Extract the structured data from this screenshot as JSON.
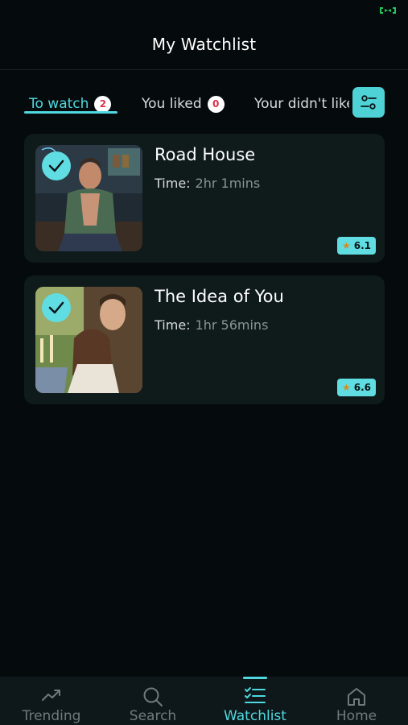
{
  "header": {
    "title": "My Watchlist"
  },
  "tabs": [
    {
      "label": "To watch",
      "count": "2",
      "active": true
    },
    {
      "label": "You liked",
      "count": "0",
      "active": false
    },
    {
      "label": "Your didn't like",
      "active": false
    }
  ],
  "movies": [
    {
      "title": "Road House",
      "time_label": "Time:",
      "time": "2hr 1mins",
      "rating": "6.1",
      "watched": true
    },
    {
      "title": "The Idea of You",
      "time_label": "Time:",
      "time": "1hr 56mins",
      "rating": "6.6",
      "watched": true
    }
  ],
  "bottom_nav": [
    {
      "label": "Trending",
      "icon": "trending-icon",
      "active": false
    },
    {
      "label": "Search",
      "icon": "search-icon",
      "active": false
    },
    {
      "label": "Watchlist",
      "icon": "watchlist-icon",
      "active": true
    },
    {
      "label": "Home",
      "icon": "home-icon",
      "active": false
    }
  ],
  "colors": {
    "background": "#050b0c",
    "accent": "#4fd8df",
    "card": "#0f1a1b",
    "badge_text": "#d9344b",
    "star": "#d98a1c"
  }
}
